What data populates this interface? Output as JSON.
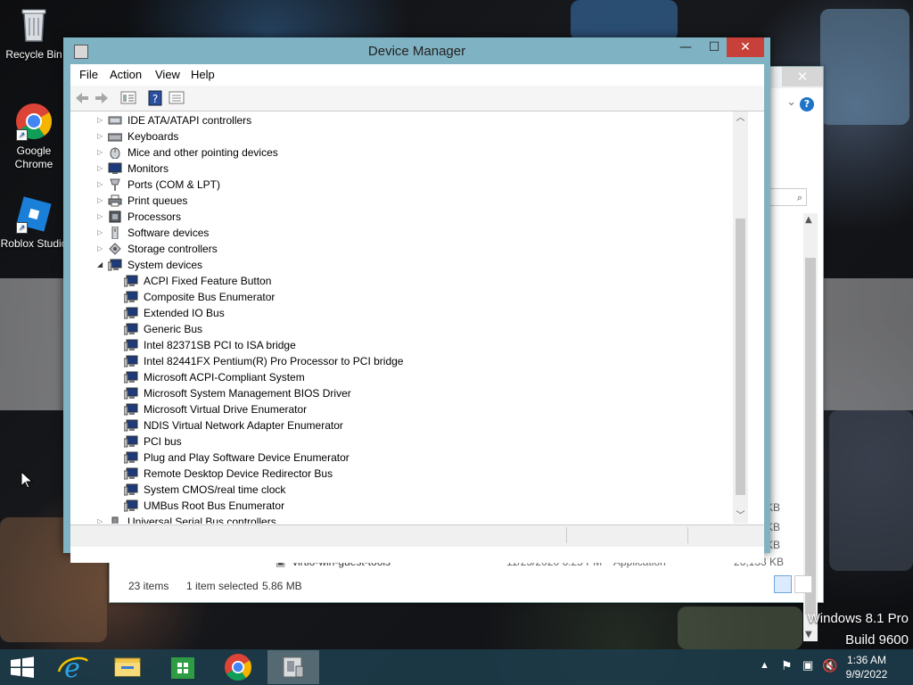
{
  "desktop": {
    "icons": [
      {
        "label": "Recycle Bin",
        "icon": "recycle-bin-icon"
      },
      {
        "label": "Google Chrome",
        "icon": "chrome-icon"
      },
      {
        "label": "Roblox Studio",
        "icon": "roblox-studio-icon"
      }
    ],
    "watermark": {
      "line1": "Windows 8.1 Pro",
      "line2": "Build 9600"
    }
  },
  "explorer": {
    "file_row": {
      "name": "virtio-win-guest-tools",
      "date": "11/23/2020 6:25 PM",
      "type": "Application",
      "size": "26,133 KB"
    },
    "size_fragments": [
      "KB",
      "KB",
      "KB"
    ],
    "status": {
      "items": "23 items",
      "selected": "1 item selected",
      "size": "5.86 MB"
    }
  },
  "device_manager": {
    "title": "Device Manager",
    "menu": [
      "File",
      "Action",
      "View",
      "Help"
    ],
    "tree": [
      {
        "label": "IDE ATA/ATAPI controllers",
        "icon": "ide-controller-icon",
        "expanded": false
      },
      {
        "label": "Keyboards",
        "icon": "keyboard-icon",
        "expanded": false
      },
      {
        "label": "Mice and other pointing devices",
        "icon": "mouse-icon",
        "expanded": false
      },
      {
        "label": "Monitors",
        "icon": "monitor-icon",
        "expanded": false
      },
      {
        "label": "Ports (COM & LPT)",
        "icon": "port-icon",
        "expanded": false
      },
      {
        "label": "Print queues",
        "icon": "printer-icon",
        "expanded": false
      },
      {
        "label": "Processors",
        "icon": "processor-icon",
        "expanded": false
      },
      {
        "label": "Software devices",
        "icon": "software-device-icon",
        "expanded": false
      },
      {
        "label": "Storage controllers",
        "icon": "storage-controller-icon",
        "expanded": false
      },
      {
        "label": "System devices",
        "icon": "system-device-icon",
        "expanded": true
      }
    ],
    "system_devices": [
      "ACPI Fixed Feature Button",
      "Composite Bus Enumerator",
      "Extended IO Bus",
      "Generic Bus",
      "Intel 82371SB PCI to ISA bridge",
      "Intel 82441FX Pentium(R) Pro Processor to PCI bridge",
      "Microsoft ACPI-Compliant System",
      "Microsoft System Management BIOS Driver",
      "Microsoft Virtual Drive Enumerator",
      "NDIS Virtual Network Adapter Enumerator",
      "PCI bus",
      "Plug and Play Software Device Enumerator",
      "Remote Desktop Device Redirector Bus",
      "System CMOS/real time clock",
      "UMBus Root Bus Enumerator"
    ],
    "partial_last_node": "Universal Serial Bus controllers"
  },
  "taskbar": {
    "apps": [
      "internet-explorer-icon",
      "file-explorer-icon",
      "store-icon",
      "chrome-icon",
      "device-manager-icon"
    ],
    "clock": {
      "time": "1:36 AM",
      "date": "9/9/2022"
    }
  }
}
